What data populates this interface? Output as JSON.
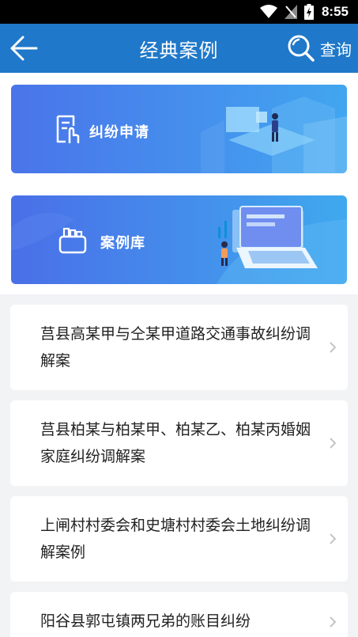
{
  "status_bar": {
    "time": "8:55"
  },
  "app_bar": {
    "title": "经典案例",
    "search_label": "查询"
  },
  "banners": [
    {
      "label": "纠纷申请"
    },
    {
      "label": "案例库"
    }
  ],
  "cases": [
    {
      "title": "莒县高某甲与仝某甲道路交通事故纠纷调解案"
    },
    {
      "title": "莒县柏某与柏某甲、柏某乙、柏某丙婚姻家庭纠纷调解案"
    },
    {
      "title": "上闸村村委会和史塘村村委会土地纠纷调解案例"
    },
    {
      "title": "阳谷县郭屯镇两兄弟的账目纠纷"
    }
  ]
}
